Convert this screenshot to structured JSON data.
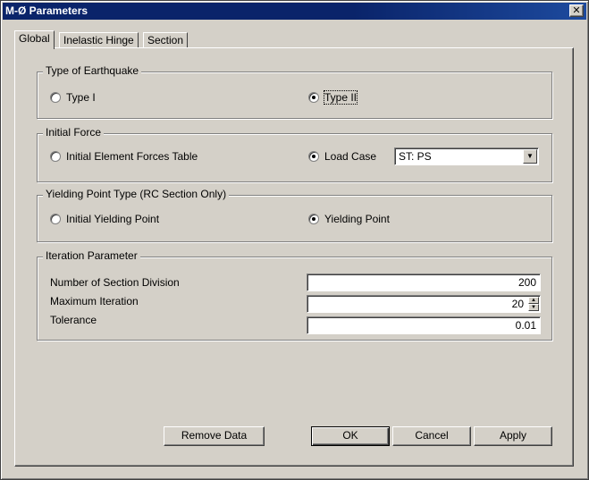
{
  "window": {
    "title": "M-Ø Parameters",
    "close_glyph": "✕"
  },
  "tabs": [
    {
      "label": "Global",
      "active": true
    },
    {
      "label": "Inelastic Hinge",
      "active": false
    },
    {
      "label": "Section",
      "active": false
    }
  ],
  "earthquake": {
    "legend": "Type of Earthquake",
    "option1": "Type I",
    "option2": "Type II",
    "selected": "Type II"
  },
  "initial_force": {
    "legend": "Initial Force",
    "option1": "Initial Element Forces Table",
    "option2": "Load Case",
    "selected": "Load Case",
    "load_case_value": "ST: PS"
  },
  "yielding": {
    "legend": "Yielding Point Type (RC Section Only)",
    "option1": "Initial Yielding Point",
    "option2": "Yielding Point",
    "selected": "Yielding Point"
  },
  "iteration": {
    "legend": "Iteration Parameter",
    "section_division_label": "Number of Section Division",
    "section_division_value": "200",
    "max_iteration_label": "Maximum Iteration",
    "max_iteration_value": "20",
    "tolerance_label": "Tolerance",
    "tolerance_value": "0.01"
  },
  "buttons": {
    "remove": "Remove Data",
    "ok": "OK",
    "cancel": "Cancel",
    "apply": "Apply"
  },
  "icons": {
    "dropdown": "▼",
    "spin_up": "▲",
    "spin_down": "▼"
  }
}
